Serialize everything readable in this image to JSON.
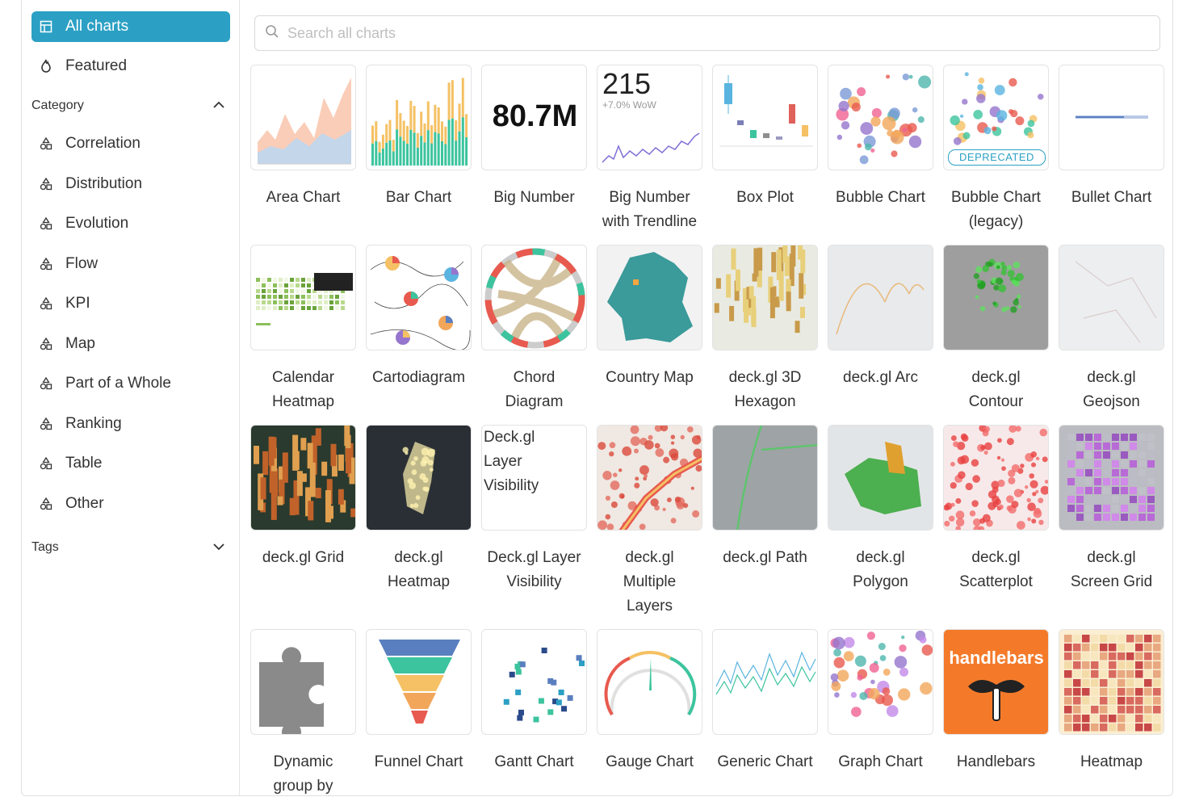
{
  "sidebar": {
    "all_charts": "All charts",
    "featured": "Featured",
    "category_title": "Category",
    "categories": [
      "Correlation",
      "Distribution",
      "Evolution",
      "Flow",
      "KPI",
      "Map",
      "Part of a Whole",
      "Ranking",
      "Table",
      "Other"
    ],
    "tags_title": "Tags"
  },
  "search": {
    "placeholder": "Search all charts"
  },
  "charts": [
    {
      "l1": "Area Chart",
      "l2": ""
    },
    {
      "l1": "Bar Chart",
      "l2": ""
    },
    {
      "l1": "Big Number",
      "l2": ""
    },
    {
      "l1": "Big Number",
      "l2": "with Trendline"
    },
    {
      "l1": "Box Plot",
      "l2": ""
    },
    {
      "l1": "Bubble Chart",
      "l2": ""
    },
    {
      "l1": "Bubble Chart",
      "l2": "(legacy)"
    },
    {
      "l1": "Bullet Chart",
      "l2": ""
    },
    {
      "l1": "Calendar",
      "l2": "Heatmap"
    },
    {
      "l1": "Cartodiagram",
      "l2": ""
    },
    {
      "l1": "Chord",
      "l2": "Diagram"
    },
    {
      "l1": "Country Map",
      "l2": ""
    },
    {
      "l1": "deck.gl 3D",
      "l2": "Hexagon"
    },
    {
      "l1": "deck.gl Arc",
      "l2": ""
    },
    {
      "l1": "deck.gl",
      "l2": "Contour"
    },
    {
      "l1": "deck.gl",
      "l2": "Geojson"
    },
    {
      "l1": "deck.gl Grid",
      "l2": ""
    },
    {
      "l1": "deck.gl",
      "l2": "Heatmap"
    },
    {
      "l1": "Deck.gl Layer",
      "l2": "Visibility"
    },
    {
      "l1": "deck.gl",
      "l2": "Multiple",
      "l3": "Layers"
    },
    {
      "l1": "deck.gl Path",
      "l2": ""
    },
    {
      "l1": "deck.gl",
      "l2": "Polygon"
    },
    {
      "l1": "deck.gl",
      "l2": "Scatterplot"
    },
    {
      "l1": "deck.gl",
      "l2": "Screen Grid"
    },
    {
      "l1": "Dynamic",
      "l2": "group by"
    },
    {
      "l1": "Funnel Chart",
      "l2": ""
    },
    {
      "l1": "Gantt Chart",
      "l2": ""
    },
    {
      "l1": "Gauge Chart",
      "l2": ""
    },
    {
      "l1": "Generic Chart",
      "l2": ""
    },
    {
      "l1": "Graph Chart",
      "l2": ""
    },
    {
      "l1": "Handlebars",
      "l2": ""
    },
    {
      "l1": "Heatmap",
      "l2": ""
    }
  ],
  "thumb_text": {
    "big_number": "80.7M",
    "trend_number": "215",
    "trend_delta": "+7.0% WoW",
    "deprecated_badge": "DEPRECATED",
    "layer_alt_1": "Deck.gl",
    "layer_alt_2": "Layer",
    "layer_alt_3": "Visibility",
    "handlebars_logo": "handlebars"
  },
  "colors": {
    "accent": "#2ba0c4"
  }
}
